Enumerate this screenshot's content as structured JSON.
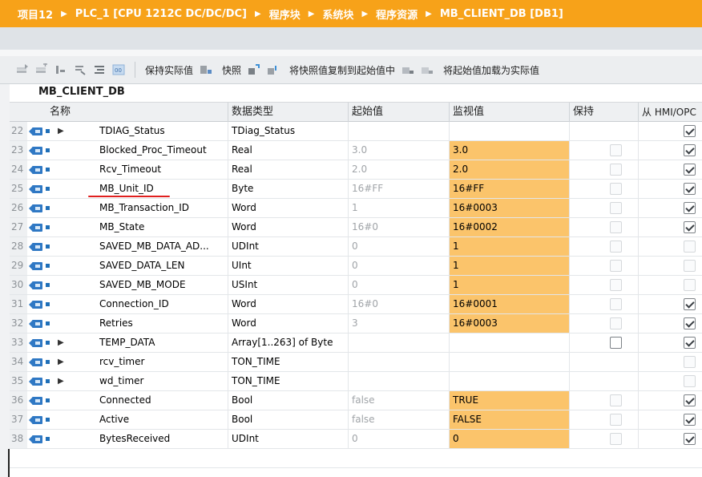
{
  "breadcrumb": [
    "项目12",
    "PLC_1 [CPU 1212C DC/DC/DC]",
    "程序块",
    "系统块",
    "程序资源",
    "MB_CLIENT_DB [DB1]"
  ],
  "toolbar": {
    "keep_actual": "保持实际值",
    "snapshot": "快照",
    "copy_snapshot": "将快照值复制到起始值中",
    "load_start": "将起始值加载为实际值"
  },
  "db_name": "MB_CLIENT_DB",
  "columns": [
    "名称",
    "数据类型",
    "起始值",
    "监视值",
    "保持",
    "从 HMI/OPC"
  ],
  "rows": [
    {
      "idx": "22",
      "expand": "▶",
      "name": "TDIAG_Status",
      "type": "TDiag_Status",
      "start": "",
      "monitor": "",
      "retain": "",
      "hmi": "on"
    },
    {
      "idx": "23",
      "expand": "",
      "name": "Blocked_Proc_Timeout",
      "type": "Real",
      "start": "3.0",
      "monitor": "3.0",
      "retain": "off",
      "hmi": "on"
    },
    {
      "idx": "24",
      "expand": "",
      "name": "Rcv_Timeout",
      "type": "Real",
      "start": "2.0",
      "monitor": "2.0",
      "retain": "off",
      "hmi": "on"
    },
    {
      "idx": "25",
      "expand": "",
      "name": "MB_Unit_ID",
      "type": "Byte",
      "start": "16#FF",
      "monitor": "16#FF",
      "retain": "off",
      "hmi": "on"
    },
    {
      "idx": "26",
      "expand": "",
      "name": "MB_Transaction_ID",
      "type": "Word",
      "start": "1",
      "monitor": "16#0003",
      "retain": "off",
      "hmi": "on"
    },
    {
      "idx": "27",
      "expand": "",
      "name": "MB_State",
      "type": "Word",
      "start": "16#0",
      "monitor": "16#0002",
      "retain": "off",
      "hmi": "on"
    },
    {
      "idx": "28",
      "expand": "",
      "name": "SAVED_MB_DATA_AD...",
      "type": "UDInt",
      "start": "0",
      "monitor": "1",
      "retain": "off",
      "hmi": "dim"
    },
    {
      "idx": "29",
      "expand": "",
      "name": "SAVED_DATA_LEN",
      "type": "UInt",
      "start": "0",
      "monitor": "1",
      "retain": "off",
      "hmi": "dim"
    },
    {
      "idx": "30",
      "expand": "",
      "name": "SAVED_MB_MODE",
      "type": "USInt",
      "start": "0",
      "monitor": "1",
      "retain": "off",
      "hmi": "dim"
    },
    {
      "idx": "31",
      "expand": "",
      "name": "Connection_ID",
      "type": "Word",
      "start": "16#0",
      "monitor": "16#0001",
      "retain": "off",
      "hmi": "on"
    },
    {
      "idx": "32",
      "expand": "",
      "name": "Retries",
      "type": "Word",
      "start": "3",
      "monitor": "16#0003",
      "retain": "off",
      "hmi": "on"
    },
    {
      "idx": "33",
      "expand": "▶",
      "name": "TEMP_DATA",
      "type": "Array[1..263] of Byte",
      "start": "",
      "monitor": "",
      "retain": "box",
      "hmi": "on"
    },
    {
      "idx": "34",
      "expand": "▶",
      "name": "rcv_timer",
      "type": "TON_TIME",
      "start": "",
      "monitor": "",
      "retain": "",
      "hmi": "dim"
    },
    {
      "idx": "35",
      "expand": "▶",
      "name": "wd_timer",
      "type": "TON_TIME",
      "start": "",
      "monitor": "",
      "retain": "",
      "hmi": "dim"
    },
    {
      "idx": "36",
      "expand": "",
      "name": "Connected",
      "type": "Bool",
      "start": "false",
      "monitor": "TRUE",
      "retain": "off",
      "hmi": "on"
    },
    {
      "idx": "37",
      "expand": "",
      "name": "Active",
      "type": "Bool",
      "start": "false",
      "monitor": "FALSE",
      "retain": "off",
      "hmi": "on"
    },
    {
      "idx": "38",
      "expand": "",
      "name": "BytesReceived",
      "type": "UDInt",
      "start": "0",
      "monitor": "0",
      "retain": "off",
      "hmi": "on"
    }
  ]
}
